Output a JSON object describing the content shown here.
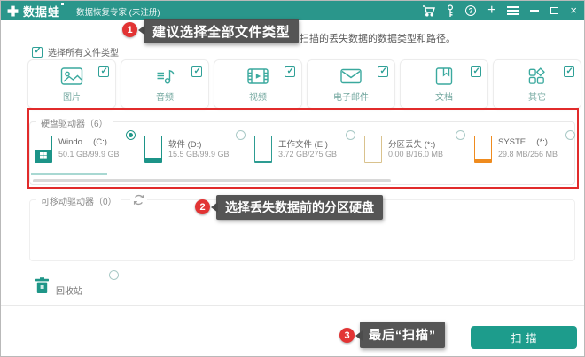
{
  "window": {
    "product_name": "数据蛙",
    "product_subtitle": "数据恢复专家 (未注册)",
    "titlebar_icons": [
      "cart-icon",
      "key-icon",
      "help-icon",
      "plus-icon",
      "menu-icon",
      "minimize-icon",
      "maximize-icon",
      "close-icon"
    ]
  },
  "instruction_text": "扫描的丢失数据的数据类型和路径。",
  "select_all": {
    "label": "选择所有文件类型",
    "checked": true
  },
  "file_types": [
    {
      "label": "图片",
      "icon": "image-icon",
      "checked": true
    },
    {
      "label": "音频",
      "icon": "audio-icon",
      "checked": true
    },
    {
      "label": "视频",
      "icon": "video-icon",
      "checked": true
    },
    {
      "label": "电子邮件",
      "icon": "email-icon",
      "checked": true
    },
    {
      "label": "文档",
      "icon": "document-icon",
      "checked": true
    },
    {
      "label": "其它",
      "icon": "other-icon",
      "checked": true
    }
  ],
  "drive_section": {
    "title": "硬盘驱动器（6）",
    "drives": [
      {
        "name": "Windo… (C:)",
        "size": "50.1 GB/99.9 GB",
        "selected": true,
        "fill_pct": 50,
        "color": "#1c9488",
        "logo": "windows"
      },
      {
        "name": "软件 (D:)",
        "size": "15.5 GB/99.9 GB",
        "selected": false,
        "fill_pct": 16,
        "color": "#1c9488",
        "logo": ""
      },
      {
        "name": "工作文件 (E:)",
        "size": "3.72 GB/275 GB",
        "selected": false,
        "fill_pct": 3,
        "color": "#2d9c92",
        "logo": ""
      },
      {
        "name": "分区丢失 (*:)",
        "size": "0.00 B/16.0 MB",
        "selected": false,
        "fill_pct": 0,
        "color": "#d9c28d",
        "logo": ""
      },
      {
        "name": "SYSTE… (*:)",
        "size": "29.8 MB/256 MB",
        "selected": false,
        "fill_pct": 13,
        "color": "#ef8b1e",
        "logo": ""
      }
    ]
  },
  "removable_section": {
    "title": "可移动驱动器（0）",
    "refresh_icon": "refresh-icon"
  },
  "recycle_bin": {
    "label": "回收站",
    "selected": false,
    "icon": "trash-icon"
  },
  "footer": {
    "scan_label": "扫描"
  },
  "annotations": [
    {
      "num": "1",
      "text": "建议选择全部文件类型"
    },
    {
      "num": "2",
      "text": "选择丢失数据前的分区硬盘"
    },
    {
      "num": "3",
      "text": "最后“扫描”"
    }
  ],
  "colors": {
    "titlebar": "#2a968b",
    "accent_teal": "#1f9688",
    "annotation_red": "#e23434",
    "tooltip_bg": "#4c4c4c",
    "drive_orange": "#ef8b1e",
    "drive_tan": "#d9c28d"
  }
}
